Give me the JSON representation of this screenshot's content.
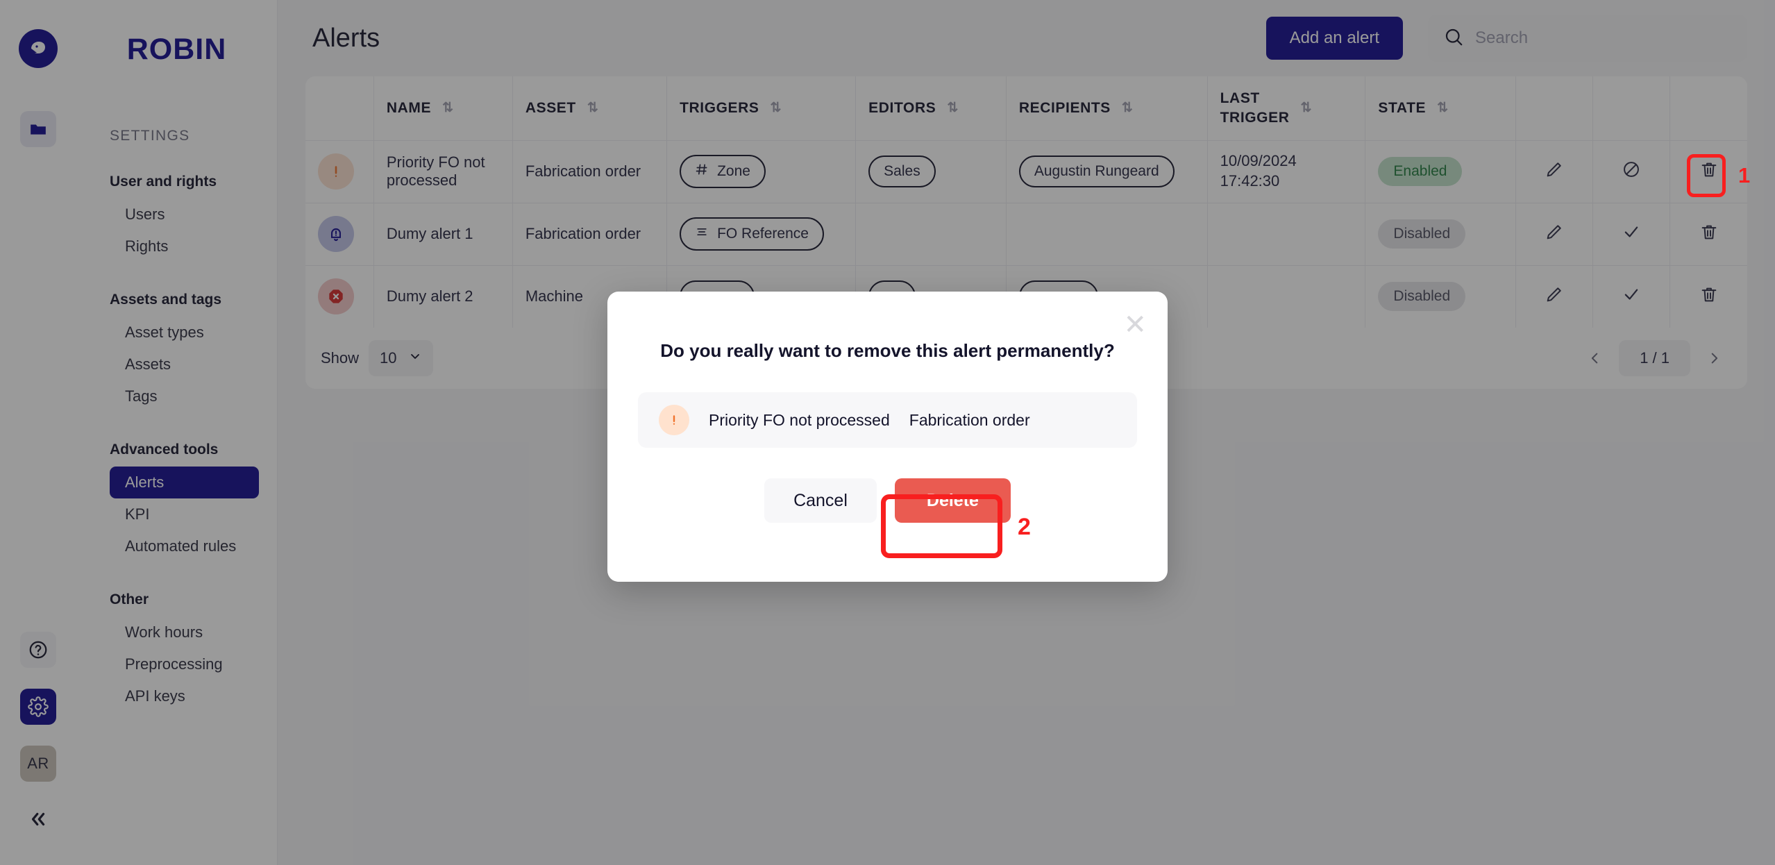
{
  "brand": {
    "name": "ROBIN",
    "logo_icon": "robin-bird-logo"
  },
  "rail": {
    "items": [
      {
        "name": "folder-icon",
        "label": ""
      },
      {
        "name": "help-icon",
        "label": "?"
      },
      {
        "name": "gear-icon",
        "label": ""
      },
      {
        "name": "avatar",
        "label": "AR"
      },
      {
        "name": "collapse-icon",
        "label": "«"
      }
    ]
  },
  "sidebar": {
    "root_label": "SETTINGS",
    "groups": [
      {
        "title": "User and rights",
        "items": [
          {
            "label": "Users",
            "active": false
          },
          {
            "label": "Rights",
            "active": false
          }
        ]
      },
      {
        "title": "Assets and tags",
        "items": [
          {
            "label": "Asset types",
            "active": false
          },
          {
            "label": "Assets",
            "active": false
          },
          {
            "label": "Tags",
            "active": false
          }
        ]
      },
      {
        "title": "Advanced tools",
        "items": [
          {
            "label": "Alerts",
            "active": true
          },
          {
            "label": "KPI",
            "active": false
          },
          {
            "label": "Automated rules",
            "active": false
          }
        ]
      },
      {
        "title": "Other",
        "items": [
          {
            "label": "Work hours",
            "active": false
          },
          {
            "label": "Preprocessing",
            "active": false
          },
          {
            "label": "API keys",
            "active": false
          }
        ]
      }
    ]
  },
  "header": {
    "title": "Alerts",
    "add_button_label": "Add an alert",
    "search": {
      "placeholder": "Search",
      "value": "",
      "icon": "search-icon"
    }
  },
  "table": {
    "columns": [
      {
        "key": "icon",
        "label": ""
      },
      {
        "key": "name",
        "label": "NAME",
        "sortable": true
      },
      {
        "key": "asset",
        "label": "ASSET",
        "sortable": true
      },
      {
        "key": "trig",
        "label": "TRIGGERS",
        "sortable": true
      },
      {
        "key": "edit",
        "label": "EDITORS",
        "sortable": true
      },
      {
        "key": "recip",
        "label": "RECIPIENTS",
        "sortable": true
      },
      {
        "key": "last",
        "label": "LAST TRIGGER",
        "label_l1": "LAST",
        "label_l2": "TRIGGER",
        "sortable": true
      },
      {
        "key": "state",
        "label": "STATE",
        "sortable": true
      },
      {
        "key": "a1",
        "label": ""
      },
      {
        "key": "a2",
        "label": ""
      },
      {
        "key": "a3",
        "label": ""
      }
    ],
    "sort_icon": "sort-updown-icon",
    "rows": [
      {
        "icon": "alert-exclamation-icon",
        "icon_kind": "warn",
        "name": "Priority FO not processed",
        "asset": "Fabrication order",
        "triggers": [
          {
            "label": "Zone",
            "icon": "hash-icon"
          }
        ],
        "editors": [
          {
            "label": "Sales"
          }
        ],
        "recipients": [
          {
            "label": "Augustin Rungeard"
          }
        ],
        "last_trigger_date": "10/09/2024",
        "last_trigger_time": "17:42:30",
        "state": "Enabled",
        "state_kind": "enabled",
        "actions": [
          "edit-icon",
          "disable-icon",
          "delete-icon"
        ]
      },
      {
        "icon": "alert-bell-icon",
        "icon_kind": "bell",
        "name": "Dumy alert 1",
        "asset": "Fabrication order",
        "triggers": [
          {
            "label": "FO Reference",
            "icon": "list-icon"
          }
        ],
        "editors": [],
        "recipients": [],
        "last_trigger_date": "",
        "last_trigger_time": "",
        "state": "Disabled",
        "state_kind": "disabled",
        "actions": [
          "edit-icon",
          "enable-check-icon",
          "delete-icon"
        ]
      },
      {
        "icon": "alert-stop-icon",
        "icon_kind": "stop",
        "name": "Dumy alert 2",
        "asset": "Machine",
        "triggers": [
          {
            "label": "",
            "icon": ""
          }
        ],
        "editors": [
          {
            "label": ""
          }
        ],
        "recipients": [
          {
            "label": ""
          }
        ],
        "last_trigger_date": "",
        "last_trigger_time": "",
        "state": "Disabled",
        "state_kind": "disabled",
        "actions": [
          "edit-icon",
          "enable-check-icon",
          "delete-icon"
        ]
      }
    ]
  },
  "footer": {
    "show_label": "Show",
    "page_size": "10",
    "page_indicator": "1 / 1",
    "prev_icon": "chevron-left-icon",
    "next_icon": "chevron-right-icon",
    "chevron_icon": "chevron-down-icon"
  },
  "modal": {
    "question": "Do you really want to remove this alert permanently?",
    "close_icon": "close-icon",
    "item": {
      "icon": "alert-exclamation-icon",
      "name": "Priority FO not processed",
      "asset": "Fabrication order"
    },
    "cancel_label": "Cancel",
    "delete_label": "Delete"
  },
  "annotations": [
    {
      "number": "1",
      "target": "delete-icon-row-1"
    },
    {
      "number": "2",
      "target": "delete-button"
    }
  ],
  "colors": {
    "brand": "#120a8f",
    "danger": "#ea5b51",
    "annotation": "#f81f1f",
    "enabled_bg": "#bfe0c8",
    "enabled_fg": "#1f7a3d",
    "disabled_bg": "#e4e4e8"
  }
}
